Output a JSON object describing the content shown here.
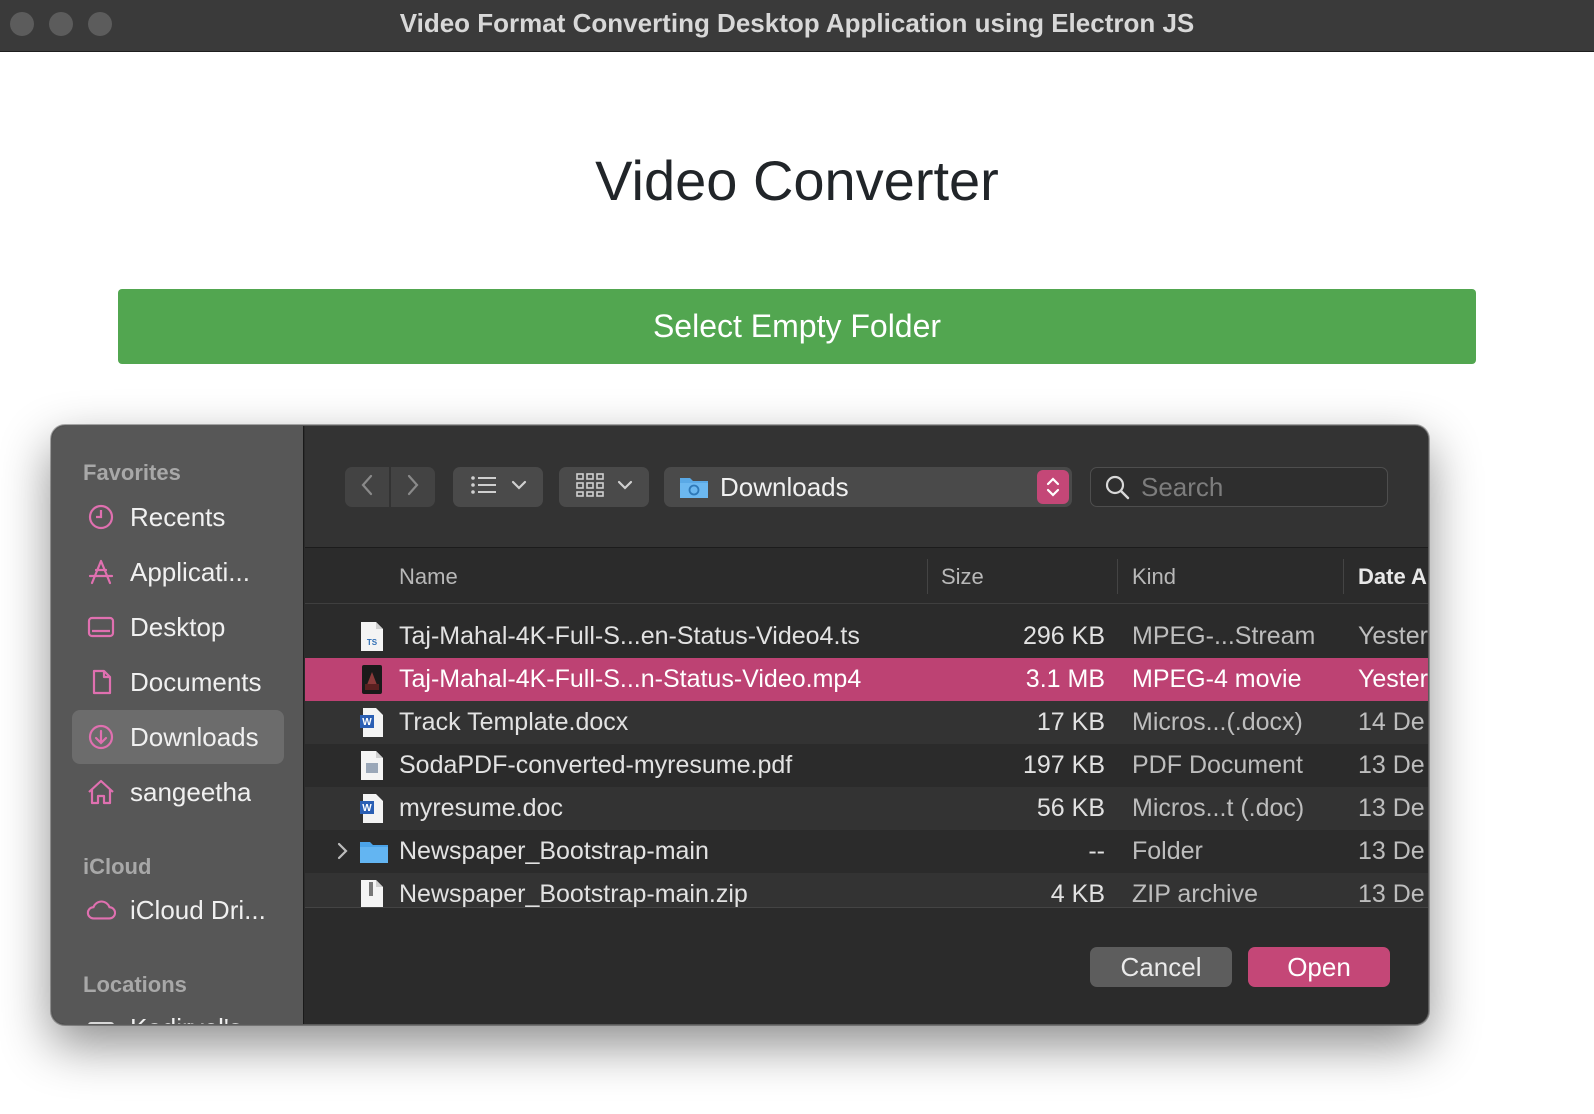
{
  "window": {
    "title": "Video Format Converting Desktop Application using Electron JS"
  },
  "app": {
    "heading": "Video Converter",
    "select_button_label": "Select Empty Folder"
  },
  "dialog": {
    "sidebar": {
      "favorites_heading": "Favorites",
      "favorites": [
        {
          "label": "Recents",
          "icon": "clock-icon"
        },
        {
          "label": "Applicati...",
          "icon": "applications-icon"
        },
        {
          "label": "Desktop",
          "icon": "desktop-icon"
        },
        {
          "label": "Documents",
          "icon": "document-icon"
        },
        {
          "label": "Downloads",
          "icon": "download-icon",
          "selected": true
        },
        {
          "label": "sangeetha",
          "icon": "home-icon"
        }
      ],
      "icloud_heading": "iCloud",
      "icloud": [
        {
          "label": "iCloud Dri...",
          "icon": "cloud-icon"
        }
      ],
      "locations_heading": "Locations",
      "locations": [
        {
          "label": "Kadirvel's",
          "icon": "computer-icon"
        }
      ]
    },
    "location": {
      "label": "Downloads"
    },
    "search": {
      "placeholder": "Search"
    },
    "columns": {
      "name": "Name",
      "size": "Size",
      "kind": "Kind",
      "date": "Date A"
    },
    "files": [
      {
        "name": "Taj-Mahal-4K-Full-S...en-Status-Video4.ts",
        "size": "296 KB",
        "kind": "MPEG-...Stream",
        "date": "Yester",
        "icon": "ts-file-icon"
      },
      {
        "name": "Taj-Mahal-4K-Full-S...n-Status-Video.mp4",
        "size": "3.1 MB",
        "kind": "MPEG-4 movie",
        "date": "Yester",
        "icon": "video-file-icon",
        "selected": true
      },
      {
        "name": "Track Template.docx",
        "size": "17 KB",
        "kind": "Micros...(.docx)",
        "date": "14 De",
        "icon": "word-file-icon"
      },
      {
        "name": "SodaPDF-converted-myresume.pdf",
        "size": "197 KB",
        "kind": "PDF Document",
        "date": "13 De",
        "icon": "pdf-file-icon"
      },
      {
        "name": "myresume.doc",
        "size": "56 KB",
        "kind": "Micros...t (.doc)",
        "date": "13 De",
        "icon": "word-file-icon"
      },
      {
        "name": "Newspaper_Bootstrap-main",
        "size": "--",
        "kind": "Folder",
        "date": "13 De",
        "icon": "folder-icon"
      },
      {
        "name": "Newspaper_Bootstrap-main.zip",
        "size": "4 KB",
        "kind": "ZIP archive",
        "date": "13 De",
        "icon": "zip-file-icon"
      }
    ],
    "cancel_label": "Cancel",
    "open_label": "Open"
  },
  "colors": {
    "accent": "#c44777",
    "primary_button": "#52a650"
  }
}
